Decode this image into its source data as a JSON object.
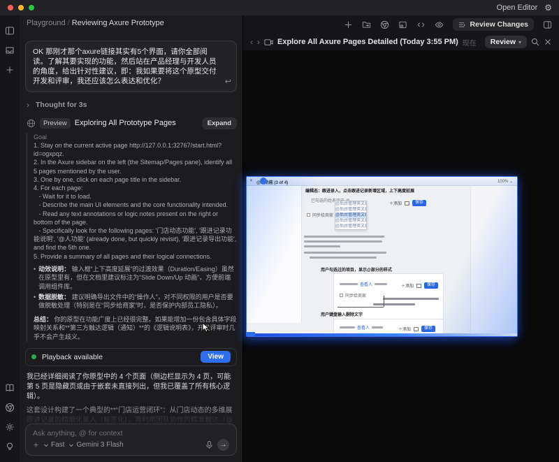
{
  "titlebar": {
    "open_editor": "Open Editor"
  },
  "breadcrumb": {
    "root": "Playground",
    "sep": "/",
    "current": "Reviewing Axure Prototype"
  },
  "chat": {
    "user_message": "OK 那刚才那个axure链接其实有5个界面，请你全部阅读。了解其要实现的功能，然后站在产品经理与开发人员的角度，给出针对性建议，即：我如果要将这个原型交付开发和评审，我还应该怎么表达和优化？",
    "thought_label": "Thought for 3s",
    "tool": {
      "badge": "Preview",
      "title": "Exploring All Prototype Pages",
      "expand_label": "Expand",
      "goal_label": "Goal",
      "goal_lines": [
        "1. Stay on the current active page http://127.0.0.1:32767/start.html?id=ogxpqz.",
        "2. In the Axure sidebar on the left (the Sitemap/Pages pane), identify all 5 pages mentioned by the user.",
        "3. One by one, click on each page title in the sidebar.",
        "4. For each page:",
        "   - Wait for it to load.",
        "   - Describe the main UI elements and the core functionality intended.",
        "   - Read any text annotations or logic notes present on the right or bottom of the page.",
        "   - Specifically look for the following pages: '门店动态功能', '跟进记录功能说明', '@人功能' (already done, but quickly revisit), '跟进记录导出功能', and find the 5th one.",
        "5. Provide a summary of all pages and their logical connections."
      ],
      "bullets": [
        {
          "label": "动效说明：",
          "text": "输入框“上下高度延展”的过渡效果（Duration/Easing）虽然在原型里有，但在文档里建议标注为“Slide Down/Up 动画”，方便前端调用组件库。"
        },
        {
          "label": "数据脱敏：",
          "text": "建议明确导出文件中的“操作人”，对不同权限的用户是否要做脱敏处理（特别是在“同步给商家”时，是否保护内部员工隐私）。"
        }
      ],
      "summary_label": "总结：",
      "summary_text": "你的原型在功能广度上已经很完整。如果能增加一份包含具体字段映射关系和**第三方触达逻辑（通知）**的《逻辑说明表》，开发评审时几乎不会产生歧义。"
    },
    "playback": {
      "status": "Playback available",
      "view_label": "View"
    },
    "paragraph_read": "我已经详细阅读了你原型中的 4 个页面（侧边栏显示为 4 页，可能第 5 页是隐藏页或由于嵌套未直接列出，但我已覆盖了所有核心逻辑）。",
    "paragraph_flow": "这套设计构建了一个典型的**“门店运营闭环”：从门店动态的多维展示**，到",
    "paragraph_faded": "跟进记录的精细化录入（标签化），再利用团队协作的精准触达（@人），最后通",
    "input": {
      "placeholder": "Ask anything, @ for context",
      "mode": "Fast",
      "model": "Gemini 3 Flash"
    }
  },
  "panel": {
    "title": "Explore All Axure Pages Detailed (Today 3:55 PM)",
    "time_badge": "现在",
    "review_label": "Review",
    "review_changes_label": "Review Changes",
    "preview": {
      "tab_close": "✕",
      "tab_title": "@人功能 (3 of 4)",
      "zoom_level": "100% ⌄",
      "heading": "编辑态：跟进录入，点击跟进记录新增区域，上下高度延展",
      "field_label": "已勾选的姓名历史 @",
      "dropdown_items": [
        "@后台管理英文姓名@",
        "@后台管理英文姓名@",
        "@后台管理英文姓名@",
        "@后台管理英文姓名@",
        "@后台管理英文姓名@"
      ],
      "checkbox_label": "同步给商家",
      "add_label": "＋添加",
      "save_label": "保存",
      "section1": "用户勾选过的项目，显示@部分的样式",
      "link_label": "查看人",
      "section2": "用户键盘输入删除文字"
    }
  },
  "colors": {
    "accent_blue": "#2f6feb",
    "playback_green": "#2ea44f",
    "preview_border": "#2e6bff"
  }
}
